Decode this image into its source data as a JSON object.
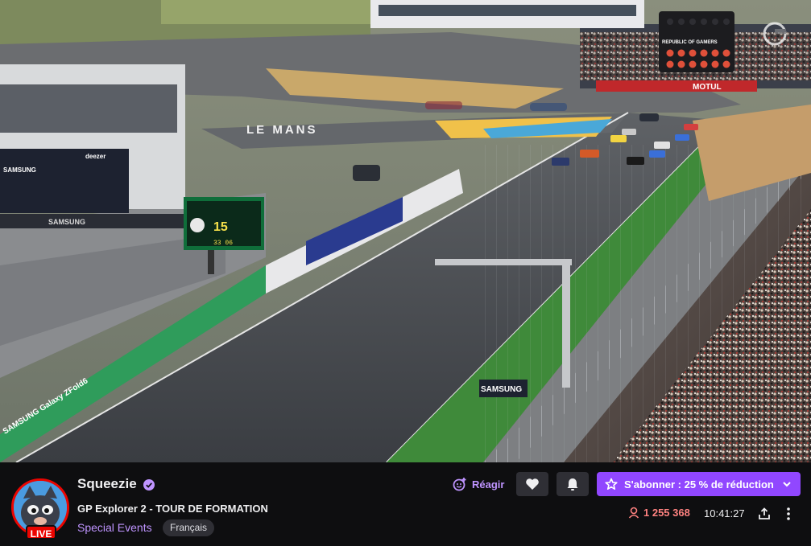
{
  "video": {
    "track_banner": "LE MANS",
    "sponsor_board": "SAMSUNG",
    "sponsor_board_2": "SAMSUNG",
    "sponsor_low": "SAMSUNG",
    "sponsor_galaxy": "SAMSUNG Galaxy ZFold6",
    "sponsor_motul": "MOTUL",
    "sponsor_deezer": "deezer",
    "lap_counter": "15",
    "lap_clock": "33 06",
    "broadcast_badge": "REPUBLIC OF GAMERS"
  },
  "channel": {
    "name": "Squeezie",
    "live_label": "LIVE",
    "title": "GP Explorer 2 - TOUR DE FORMATION",
    "category": "Special Events",
    "language_tag": "Français"
  },
  "actions": {
    "react_label": "Réagir",
    "subscribe_label": "S'abonner : 25 % de réduction"
  },
  "stats": {
    "viewers": "1 255 368",
    "uptime": "10:41:27"
  },
  "colors": {
    "accent": "#9147ff",
    "live": "#eb0400",
    "viewer_count": "#ff8280"
  },
  "icons": {
    "react": "smiley-plus-icon",
    "follow": "heart-icon",
    "notify": "bell-icon",
    "subscribe": "star-icon",
    "subscribe_menu": "chevron-down-icon",
    "viewers": "person-icon",
    "share": "share-icon",
    "more": "more-vertical-icon",
    "verified": "verified-badge-icon"
  }
}
